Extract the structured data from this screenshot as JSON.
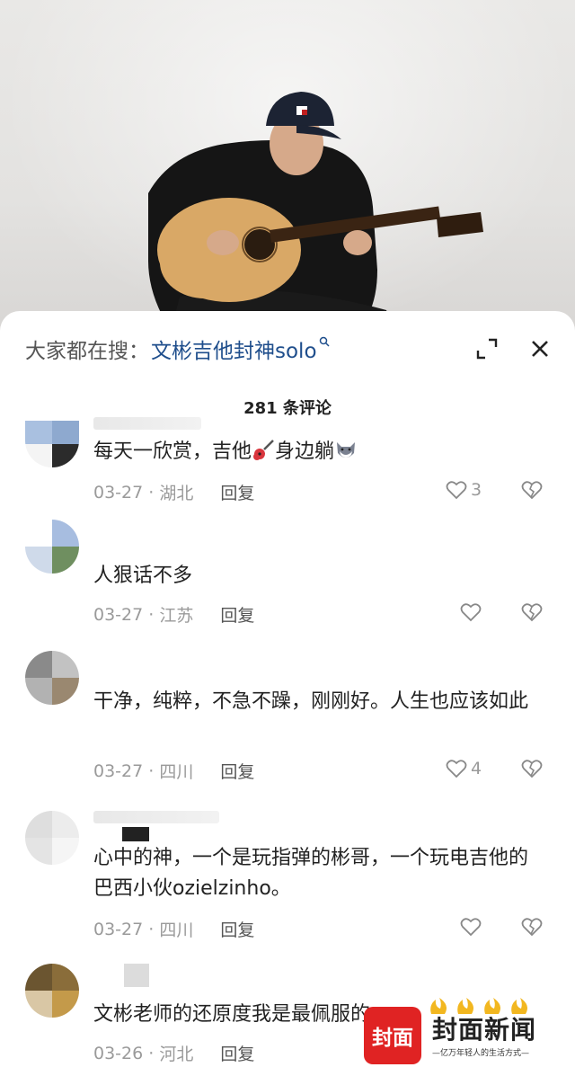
{
  "header": {
    "search_prefix": "大家都在搜：",
    "search_term": "文彬吉他封神solo",
    "search_icon": "search-icon",
    "expand_icon": "expand-icon",
    "close_icon": "close-icon"
  },
  "comment_count": "281 条评论",
  "comments": [
    {
      "text_before": "每天一欣赏，吉他",
      "text_middle": "身边躺",
      "date": "03-27",
      "location": "湖北",
      "reply": "回复",
      "likes": "3",
      "emojis": [
        "guitar-emoji",
        "dog-emoji"
      ]
    },
    {
      "text": "人狠话不多",
      "date": "03-27",
      "location": "江苏",
      "reply": "回复",
      "likes": ""
    },
    {
      "text": "干净，纯粹，不急不躁，刚刚好。人生也应该如此",
      "date": "03-27",
      "location": "四川",
      "reply": "回复",
      "likes": "4"
    },
    {
      "text": "心中的神，一个是玩指弹的彬哥，一个玩电吉他的巴西小伙ozielzinho。",
      "date": "03-27",
      "location": "四川",
      "reply": "回复",
      "likes": ""
    },
    {
      "text": "文彬老师的还原度我是最佩服的",
      "date": "03-26",
      "location": "河北",
      "reply": "回复",
      "likes": ""
    }
  ],
  "meta_separator": " · ",
  "watermark": {
    "logo_text": "封面",
    "name": "封面新闻",
    "slogan": "—亿万年轻人的生活方式—"
  },
  "colors": {
    "accent": "#1f4e8c",
    "meta": "#9a9a9a",
    "brand_red": "#e02323"
  }
}
